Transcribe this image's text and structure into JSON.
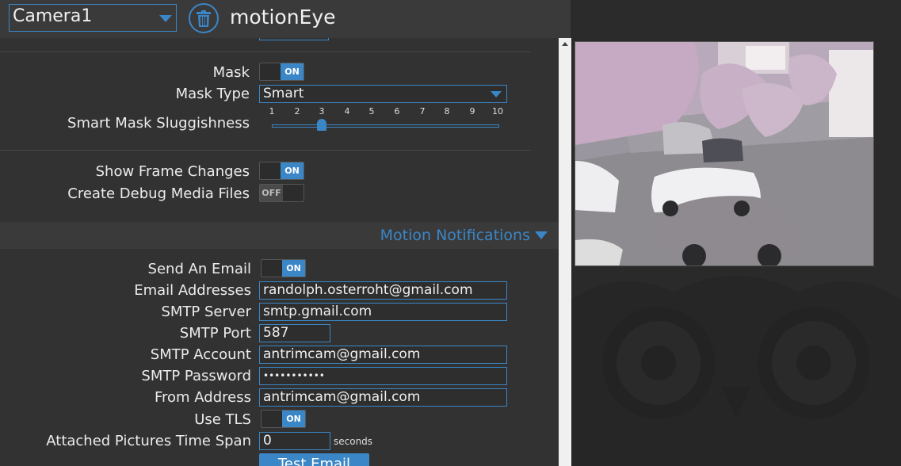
{
  "header": {
    "camera_select": "Camera1",
    "brand": "motionEye"
  },
  "settings": {
    "mask_label": "Mask",
    "mask_toggle": "ON",
    "mask_type_label": "Mask Type",
    "mask_type_value": "Smart",
    "sluggishness_label": "Smart Mask Sluggishness",
    "sluggishness_ticks": [
      "1",
      "2",
      "3",
      "4",
      "5",
      "6",
      "7",
      "8",
      "9",
      "10"
    ],
    "sluggishness_value": 3,
    "show_frame_changes_label": "Show Frame Changes",
    "show_frame_changes_toggle": "ON",
    "debug_media_label": "Create Debug Media Files",
    "debug_media_toggle": "OFF"
  },
  "motion_notifications": {
    "title": "Motion Notifications",
    "send_email_label": "Send An Email",
    "send_email_toggle": "ON",
    "email_addresses_label": "Email Addresses",
    "email_addresses_value": "randolph.osterroht@gmail.com",
    "smtp_server_label": "SMTP Server",
    "smtp_server_value": "smtp.gmail.com",
    "smtp_port_label": "SMTP Port",
    "smtp_port_value": "587",
    "smtp_account_label": "SMTP Account",
    "smtp_account_value": "antrimcam@gmail.com",
    "smtp_password_label": "SMTP Password",
    "smtp_password_value": "•••••••••••",
    "from_address_label": "From Address",
    "from_address_value": "antrimcam@gmail.com",
    "use_tls_label": "Use TLS",
    "use_tls_toggle": "ON",
    "pictures_span_label": "Attached Pictures Time Span",
    "pictures_span_value": "0",
    "pictures_span_unit": "seconds",
    "test_email_button": "Test Email"
  },
  "colors": {
    "accent": "#3b86c6",
    "panel": "#323232",
    "topbar": "#3a3a3a"
  }
}
